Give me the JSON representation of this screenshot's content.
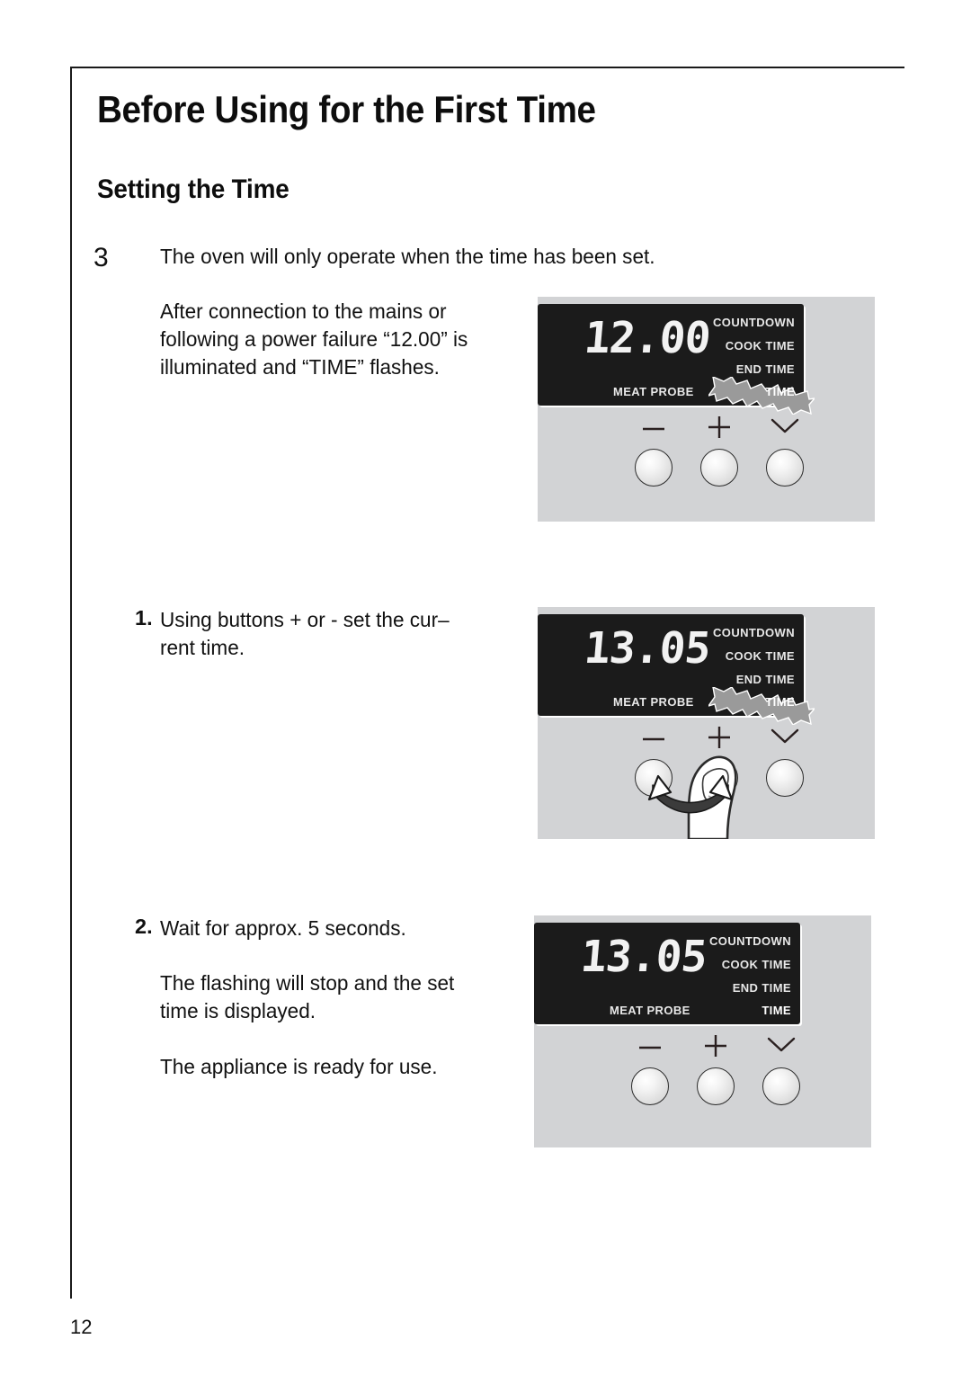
{
  "document": {
    "chapter_title": "Before Using for the First Time",
    "section_title": "Setting the Time",
    "page_number": "12"
  },
  "content": {
    "step_number": "3",
    "intro": "The oven will only operate when the time has been set.",
    "intro_note_line1": "After connection to the mains or",
    "intro_note_line2": "following a power failure “12.00” is",
    "intro_note_line3": "illuminated and “TIME” flashes.",
    "item1_marker": "1.",
    "item1_line1": "Using buttons +   or -    set the cur–",
    "item1_line2": "rent time.",
    "item2_marker": "2.",
    "item2_line1": "Wait for approx. 5 seconds.",
    "item2_note_line1": "The flashing will stop and the set",
    "item2_note_line2": "time is displayed.",
    "item2_note_line3": "The appliance is ready for use."
  },
  "illustrations": [
    {
      "id": "panel-1",
      "display_value": "12.00",
      "labels": [
        "COUNTDOWN",
        "COOK TIME",
        "END TIME"
      ],
      "meat_probe_label": "MEAT PROBE",
      "time_label": "TIME",
      "time_flashing": true,
      "buttons": [
        {
          "symbol": "minus",
          "name": "decrease-button"
        },
        {
          "symbol": "plus",
          "name": "increase-button"
        },
        {
          "symbol": "chevron-down",
          "name": "select-button"
        }
      ],
      "finger_shown": false
    },
    {
      "id": "panel-2",
      "display_value": "13.05",
      "labels": [
        "COUNTDOWN",
        "COOK TIME",
        "END TIME"
      ],
      "meat_probe_label": "MEAT PROBE",
      "time_label": "TIME",
      "time_flashing": true,
      "buttons": [
        {
          "symbol": "minus",
          "name": "decrease-button"
        },
        {
          "symbol": "plus",
          "name": "increase-button"
        },
        {
          "symbol": "chevron-down",
          "name": "select-button"
        }
      ],
      "finger_shown": true
    },
    {
      "id": "panel-3",
      "display_value": "13.05",
      "labels": [
        "COUNTDOWN",
        "COOK TIME",
        "END TIME"
      ],
      "meat_probe_label": "MEAT PROBE",
      "time_label": "TIME",
      "time_flashing": false,
      "buttons": [
        {
          "symbol": "minus",
          "name": "decrease-button"
        },
        {
          "symbol": "plus",
          "name": "increase-button"
        },
        {
          "symbol": "chevron-down",
          "name": "select-button"
        }
      ],
      "finger_shown": false
    }
  ],
  "colors": {
    "panel_gray": "#d2d3d5",
    "lcd_black": "#1b1b1b",
    "lcd_text": "#f2f2f2",
    "flash_gray": "#9a9a9a",
    "ink": "#111111"
  }
}
